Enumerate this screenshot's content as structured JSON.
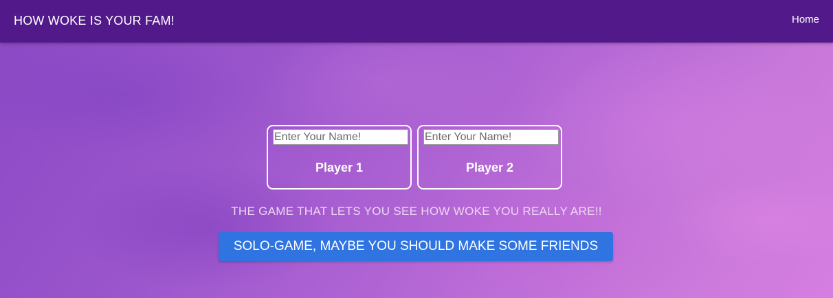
{
  "navbar": {
    "brand": "HOW WOKE IS YOUR FAM!",
    "home_link": "Home"
  },
  "players": [
    {
      "label": "Player 1",
      "placeholder": "Enter Your Name!",
      "value": ""
    },
    {
      "label": "Player 2",
      "placeholder": "Enter Your Name!",
      "value": ""
    }
  ],
  "tagline": "THE GAME THAT LETS YOU SEE HOW WOKE YOU REALLY ARE!!",
  "solo_button": "SOLO-GAME, MAYBE YOU SHOULD MAKE SOME FRIENDS",
  "colors": {
    "navbar_bg": "#52198b",
    "button_bg": "#2f74e0",
    "background_accent": "#b064d4"
  }
}
